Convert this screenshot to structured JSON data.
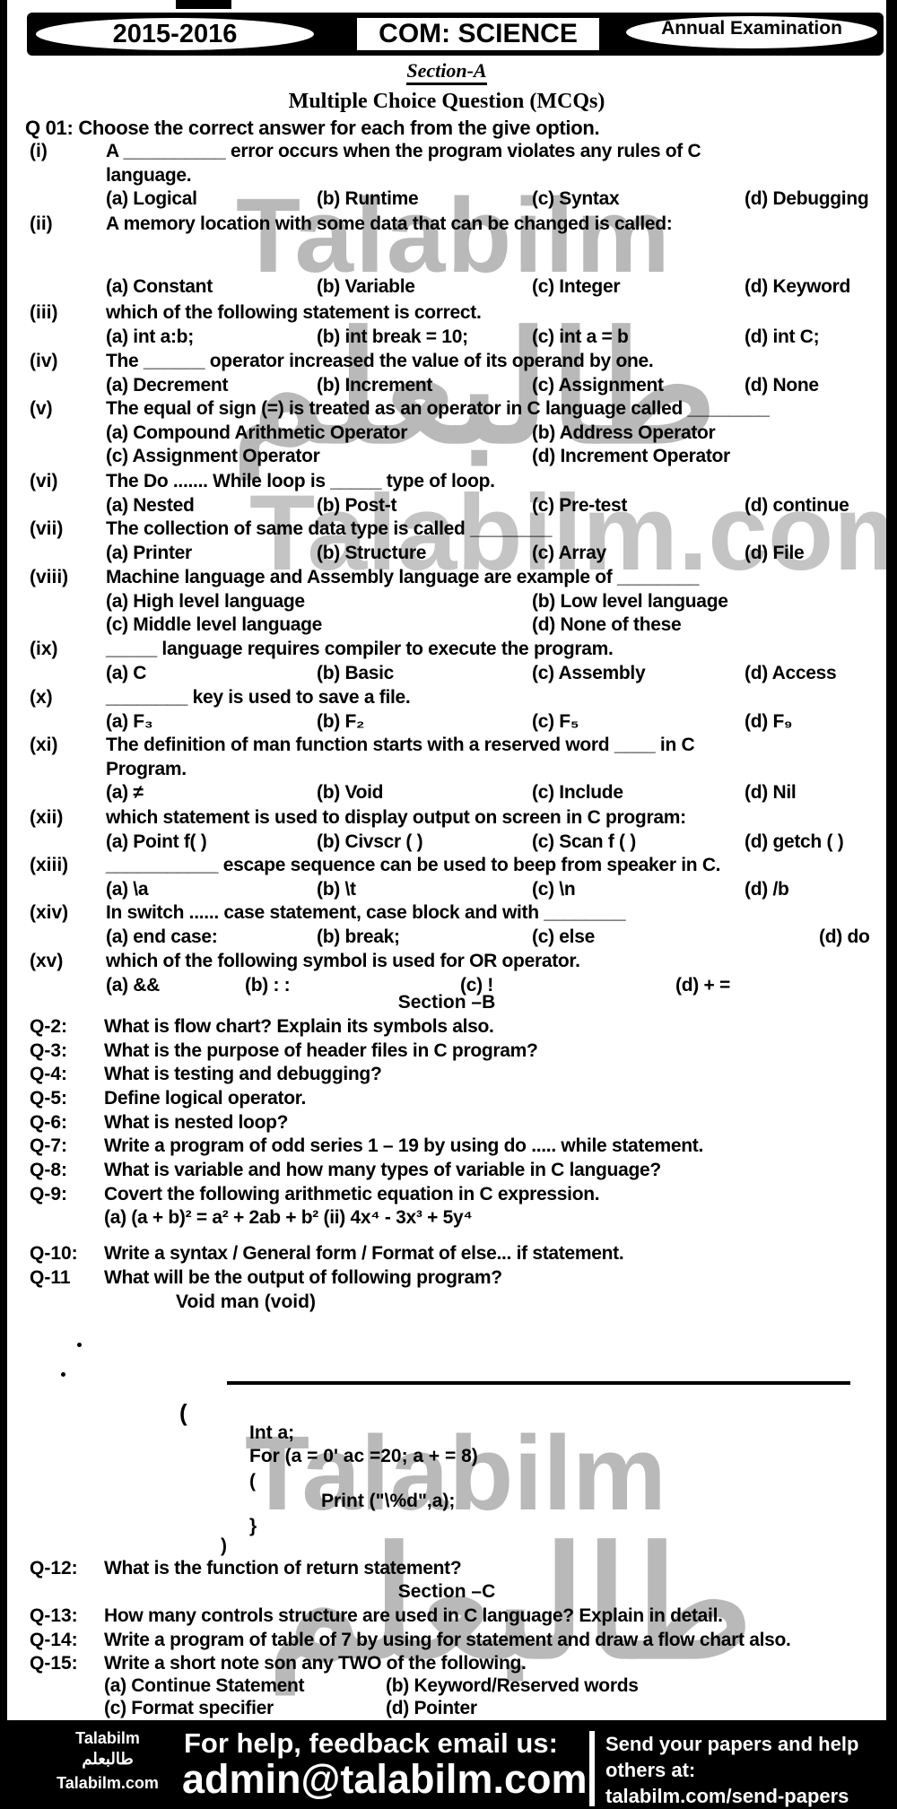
{
  "header": {
    "year": "2015-2016",
    "subject": "COM: SCIENCE",
    "exam": "Annual Examination"
  },
  "watermark": {
    "latin": "Talabilm",
    "latin_domain": "Talabilm.com",
    "arabic": "طالبعلم"
  },
  "section_a": {
    "title": "Section-A",
    "subtitle": "Multiple Choice Question (MCQs)",
    "instruction": "Q 01: Choose the correct answer for each from the give option.",
    "questions": [
      {
        "num": "(i)",
        "text": "A __________ error occurs when the program violates any rules of C",
        "text2": "language.",
        "options": [
          "(a) Logical",
          "(b) Runtime",
          "(c) Syntax",
          "(d) Debugging"
        ]
      },
      {
        "num": "(ii)",
        "text": "A memory location with some data that can be changed is called:",
        "options": [
          "(a) Constant",
          "(b) Variable",
          "(c) Integer",
          "(d) Keyword"
        ]
      },
      {
        "num": "(iii)",
        "text": "which of the following statement is correct.",
        "options": [
          "(a) int a:b;",
          "(b) int break = 10;",
          "(c) int a = b",
          "(d) int C;"
        ]
      },
      {
        "num": "(iv)",
        "text": "The ______ operator increased the value of its operand by one.",
        "options": [
          "(a) Decrement",
          "(b) Increment",
          "(c) Assignment",
          "(d) None"
        ]
      },
      {
        "num": "(v)",
        "text": "The equal of sign (=) is treated as an operator in C language called ________",
        "options": [
          "(a) Compound Arithmetic Operator",
          "(b) Address Operator",
          "(c) Assignment Operator",
          "(d) Increment Operator"
        ]
      },
      {
        "num": "(vi)",
        "text": "The Do ....... While loop is _____ type of loop.",
        "options": [
          "(a) Nested",
          "(b) Post-t",
          "(c) Pre-test",
          "(d) continue"
        ]
      },
      {
        "num": "(vii)",
        "text": "The collection of same data type is called ________",
        "options": [
          "(a) Printer",
          "(b) Structure",
          "(c) Array",
          "(d) File"
        ]
      },
      {
        "num": "(viii)",
        "text": "Machine language and Assembly language are example of ________",
        "options": [
          "(a) High level language",
          "(b) Low level language",
          "(c) Middle level language",
          "(d) None of these"
        ]
      },
      {
        "num": "(ix)",
        "text": "_____ language requires compiler to execute the program.",
        "options": [
          "(a) C",
          "(b) Basic",
          "(c) Assembly",
          "(d) Access"
        ]
      },
      {
        "num": "(x)",
        "text": "________ key is used to save a file.",
        "options": [
          "(a) F₃",
          "(b) F₂",
          "(c) F₅",
          "(d) F₉"
        ]
      },
      {
        "num": "(xi)",
        "text": "The definition of man function starts with a reserved word ____ in C",
        "text2": "Program.",
        "options": [
          "(a) ≠",
          "(b) Void",
          "(c) Include",
          "(d) Nil"
        ]
      },
      {
        "num": "(xii)",
        "text": "which statement is used to display output on screen in C program:",
        "options": [
          "(a) Point f( )",
          "(b) Civscr ( )",
          "(c) Scan f ( )",
          "(d) getch ( )"
        ]
      },
      {
        "num": "(xiii)",
        "text": "___________ escape sequence can be used to beep from speaker in C.",
        "options": [
          "(a) \\a",
          "(b) \\t",
          "(c) \\n",
          "(d) /b"
        ]
      },
      {
        "num": "(xiv)",
        "text": "In switch ...... case statement, case block and with ________",
        "options": [
          "(a) end case:",
          "(b) break;",
          "(c) else",
          "(d) do"
        ]
      },
      {
        "num": "(xv)",
        "text": "which of the following symbol is used for OR operator.",
        "options": [
          "(a) &&",
          "(b) : :",
          "(c) !",
          "(d) + ="
        ]
      }
    ]
  },
  "section_b": {
    "title": "Section –B",
    "questions": [
      {
        "num": "Q-2:",
        "text": "What is flow chart? Explain its symbols also."
      },
      {
        "num": "Q-3:",
        "text": "What is the purpose of header files in C program?"
      },
      {
        "num": "Q-4:",
        "text": "What is testing and debugging?"
      },
      {
        "num": "Q-5:",
        "text": "Define logical operator."
      },
      {
        "num": "Q-6:",
        "text": "What is nested loop?"
      },
      {
        "num": "Q-7:",
        "text": "Write a program of odd series 1 – 19 by using do ..... while statement."
      },
      {
        "num": "Q-8:",
        "text": "What is variable and how many types of variable in C language?"
      },
      {
        "num": "Q-9:",
        "text": "Covert the following arithmetic equation in C expression.",
        "sub": "(a) (a + b)² = a² + 2ab + b²     (ii) 4x⁴ - 3x³ + 5y⁴"
      },
      {
        "num": "Q-10:",
        "text": "Write a syntax / General form / Format of else... if statement."
      },
      {
        "num": "Q-11",
        "text": "What will be the output of following program?"
      }
    ],
    "program": {
      "signature": "Void man (void)",
      "open_brace": "(",
      "lines": [
        "Int a;",
        "For (a = 0' ac =20; a + = 8)",
        "(",
        "Print (\"\\%d\",a);",
        "}",
        ")"
      ]
    },
    "q12": {
      "num": "Q-12:",
      "text": "What is the function of return statement?"
    }
  },
  "section_c": {
    "title": "Section –C",
    "questions": [
      {
        "num": "Q-13:",
        "text": "How many controls structure are used in C language? Explain in detail."
      },
      {
        "num": "Q-14:",
        "text": "Write a program of table of 7 by using for statement and draw a flow chart also."
      },
      {
        "num": "Q-15:",
        "text": "Write a short note son any TWO of the following."
      }
    ],
    "q15_options": [
      "(a) Continue Statement",
      "(b) Keyword/Reserved words",
      "(c) Format specifier",
      "(d) Pointer"
    ]
  },
  "footer": {
    "brand": "Talabilm",
    "brand_arabic": "طالبعلم",
    "brand_domain": "Talabilm.com",
    "help_text": "For help, feedback email us:",
    "email": "admin@talabilm.com",
    "send_text_1": "Send your papers and help",
    "send_text_2": "others at:",
    "send_link": "talabilm.com/send-papers"
  }
}
